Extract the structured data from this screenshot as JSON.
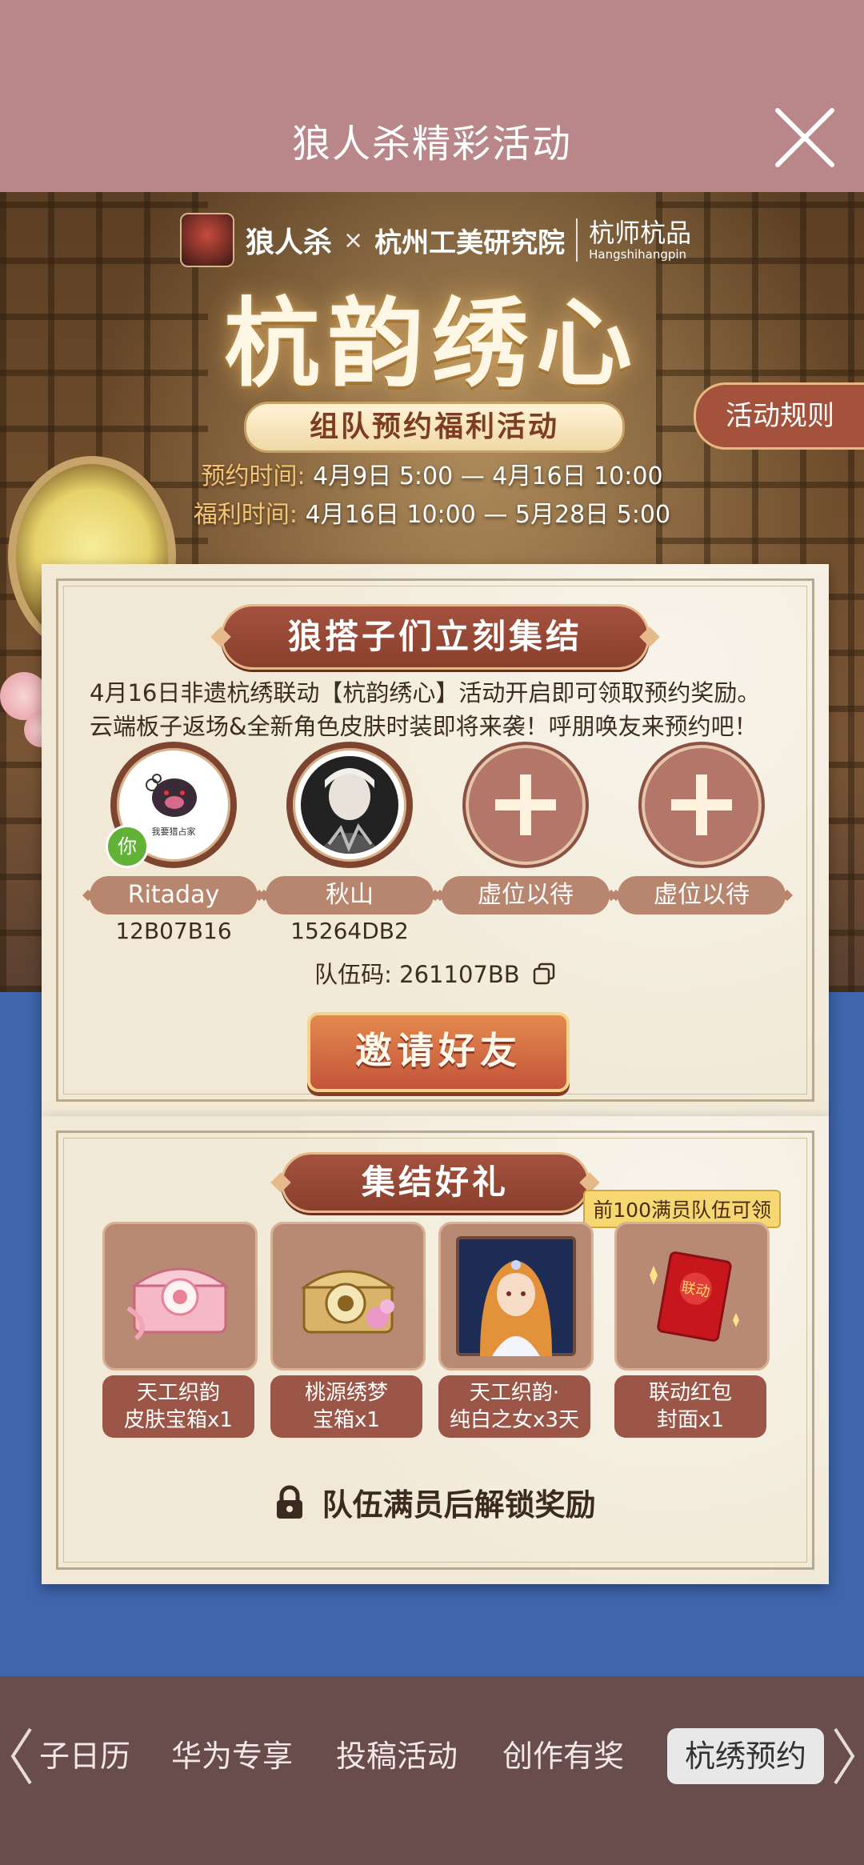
{
  "header": {
    "title": "狼人杀精彩活动"
  },
  "banner": {
    "logo_game": "狼人杀",
    "logo_x": "×",
    "logo_partner": "杭州工美研究院",
    "logo_brand_cn": "杭师杭品",
    "logo_brand_en": "Hangshihangpin",
    "main_title": "杭韵绣心",
    "subtitle": "组队预约福利活动",
    "reserve_label": "预约时间:",
    "reserve_time": "4月9日 5:00 — 4月16日 10:00",
    "benefit_label": "福利时间:",
    "benefit_time": "4月16日 10:00 — 5月28日 5:00",
    "rules_button": "活动规则"
  },
  "team_section": {
    "title": "狼搭子们立刻集结",
    "desc_line1": "4月16日非遗杭绣联动【杭韵绣心】活动开启即可领取预约奖励。",
    "desc_line2": "云端板子返场&全新角色皮肤时装即将来袭！呼朋唤友来预约吧！",
    "members": [
      {
        "name": "Ritaday",
        "id": "12B07B16",
        "badge": "你",
        "avatar_text": "我要猎占家"
      },
      {
        "name": "秋山",
        "id": "15264DB2"
      },
      {
        "name": "虚位以待"
      },
      {
        "name": "虚位以待"
      }
    ],
    "team_code_label": "队伍码:",
    "team_code": "261107BB",
    "invite_button": "邀请好友"
  },
  "reward_section": {
    "title": "集结好礼",
    "limit_tag": "前100满员队伍可领",
    "rewards": [
      {
        "line1": "天工织韵",
        "line2": "皮肤宝箱x1",
        "icon": "pink-treasure-chest-icon"
      },
      {
        "line1": "桃源绣梦",
        "line2": "宝箱x1",
        "icon": "gold-treasure-chest-icon"
      },
      {
        "line1": "天工织韵·",
        "line2": "纯白之女x3天",
        "icon": "character-portrait"
      },
      {
        "line1": "联动红包",
        "line2": "封面x1",
        "icon": "red-envelope-icon",
        "envelope_text": "联动"
      }
    ],
    "unlock_text": "队伍满员后解锁奖励"
  },
  "tabs": {
    "items": [
      "子日历",
      "华为专享",
      "投稿活动",
      "创作有奖",
      "杭绣预约"
    ],
    "active_index": 4
  },
  "colors": {
    "header_bg": "#b98689",
    "tabbar_bg": "#694d4c",
    "accent_red": "#9c5647",
    "card_bg": "#f1e9d6",
    "page_bg": "#3f65ad"
  }
}
